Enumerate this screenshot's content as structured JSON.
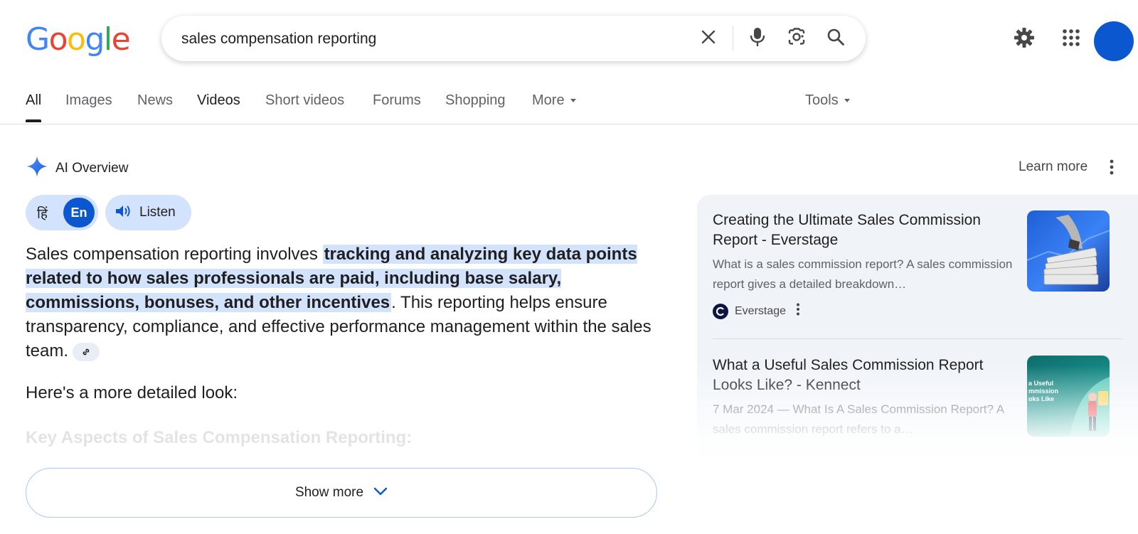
{
  "logo": {
    "letters": [
      "G",
      "o",
      "o",
      "g",
      "l",
      "e"
    ],
    "colors": [
      "#4285F4",
      "#EA4335",
      "#FBBC05",
      "#4285F4",
      "#34A853",
      "#EA4335"
    ]
  },
  "search": {
    "query": "sales compensation reporting"
  },
  "tabs": [
    {
      "label": "All"
    },
    {
      "label": "Images"
    },
    {
      "label": "News"
    },
    {
      "label": "Videos"
    },
    {
      "label": "Short videos"
    },
    {
      "label": "Forums"
    },
    {
      "label": "Shopping"
    },
    {
      "label": "More"
    }
  ],
  "tools_label": "Tools",
  "ai_overview": {
    "title": "AI Overview",
    "learn_more": "Learn more",
    "lang_hi": "हिं",
    "lang_en": "En",
    "listen_label": "Listen",
    "para_start": "Sales compensation reporting involves ",
    "para_highlight": "tracking and analyzing key data points related to how sales professionals are paid, including base salary, commissions, bonuses, and other incentives",
    "para_end": ". This reporting helps ensure transparency, compliance, and effective performance management within the sales team.",
    "para2": "Here's a more detailed look:",
    "faded_heading": "Key Aspects of Sales Compensation Reporting:",
    "show_more": "Show more"
  },
  "sources": [
    {
      "title": "Creating the Ultimate Sales Commission Report - Everstage",
      "snippet": "What is a sales commission report? A sales commission report gives a detailed breakdown…",
      "source_name": "Everstage"
    },
    {
      "title": "What a Useful Sales Commission Report Looks Like? - Kennect",
      "snippet": "7 Mar 2024 — What Is A Sales Commission Report? A sales commission report refers to a…",
      "thumb_text": "a Useful mmission oks Like"
    }
  ],
  "colors": {
    "accent": "#0b57d0",
    "highlight": "#d3e3fd",
    "chip_bg": "#f0f4f9"
  }
}
